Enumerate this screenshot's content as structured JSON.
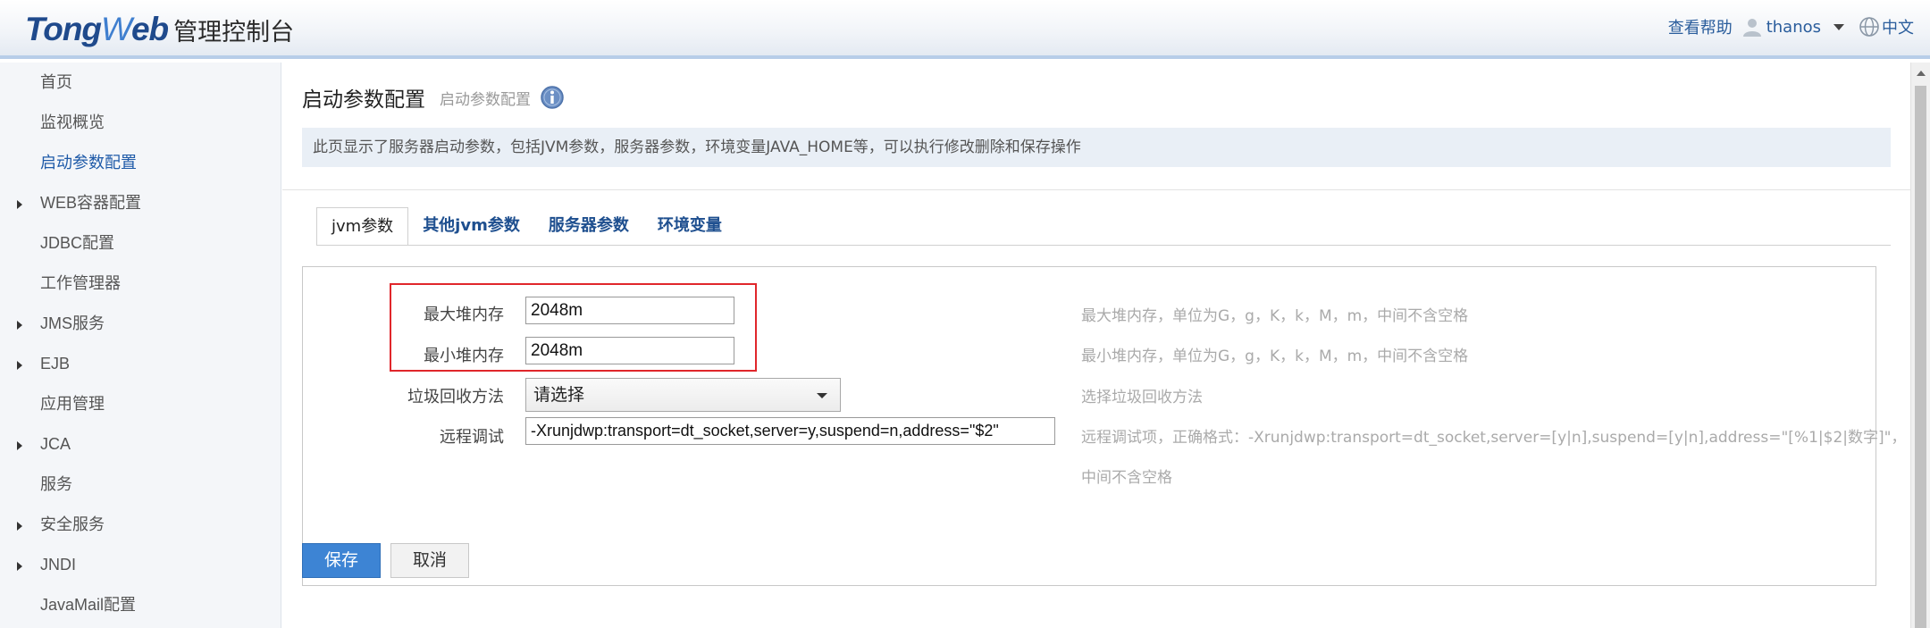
{
  "header": {
    "brand_tong": "Tong",
    "brand_w": "W",
    "brand_eb": "eb",
    "console_title": "管理控制台",
    "help": "查看帮助",
    "username": "thanos",
    "language": "中文",
    "icons": [
      "user-icon",
      "caret-down-icon",
      "globe-icon"
    ]
  },
  "sidebar": {
    "items": [
      {
        "label": "首页",
        "expandable": false
      },
      {
        "label": "监视概览",
        "expandable": false
      },
      {
        "label": "启动参数配置",
        "expandable": false,
        "active": true
      },
      {
        "label": "WEB容器配置",
        "expandable": true
      },
      {
        "label": "JDBC配置",
        "expandable": false
      },
      {
        "label": "工作管理器",
        "expandable": false
      },
      {
        "label": "JMS服务",
        "expandable": true
      },
      {
        "label": "EJB",
        "expandable": true
      },
      {
        "label": "应用管理",
        "expandable": false
      },
      {
        "label": "JCA",
        "expandable": true
      },
      {
        "label": "服务",
        "expandable": false
      },
      {
        "label": "安全服务",
        "expandable": true
      },
      {
        "label": "JNDI",
        "expandable": true
      },
      {
        "label": "JavaMail配置",
        "expandable": false
      }
    ]
  },
  "main": {
    "title": "启动参数配置",
    "breadcrumb": "启动参数配置",
    "description": "此页显示了服务器启动参数，包括JVM参数，服务器参数，环境变量JAVA_HOME等，可以执行修改删除和保存操作",
    "tabs": [
      {
        "label": "jvm参数",
        "active": true
      },
      {
        "label": "其他jvm参数",
        "active": false
      },
      {
        "label": "服务器参数",
        "active": false
      },
      {
        "label": "环境变量",
        "active": false
      }
    ],
    "form": {
      "max_heap": {
        "label": "最大堆内存",
        "value": "2048m",
        "hint": "最大堆内存，单位为G，g，K，k，M，m，中间不含空格"
      },
      "min_heap": {
        "label": "最小堆内存",
        "value": "2048m",
        "hint": "最小堆内存，单位为G，g，K，k，M，m，中间不含空格"
      },
      "gc": {
        "label": "垃圾回收方法",
        "value": "请选择",
        "hint": "选择垃圾回收方法"
      },
      "debug": {
        "label": "远程调试",
        "value": "-Xrunjdwp:transport=dt_socket,server=y,suspend=n,address=\"$2\"",
        "hint_line1": "远程调试项，正确格式：-Xrunjdwp:transport=dt_socket,server=[y|n],suspend=[y|n],address=\"[%1|$2|数字]\"，",
        "hint_line2": "中间不含空格"
      }
    },
    "buttons": {
      "save": "保存",
      "cancel": "取消"
    }
  },
  "colors": {
    "accent": "#3d84d4",
    "highlight": "#e0262b",
    "link": "#1e5aa8"
  }
}
